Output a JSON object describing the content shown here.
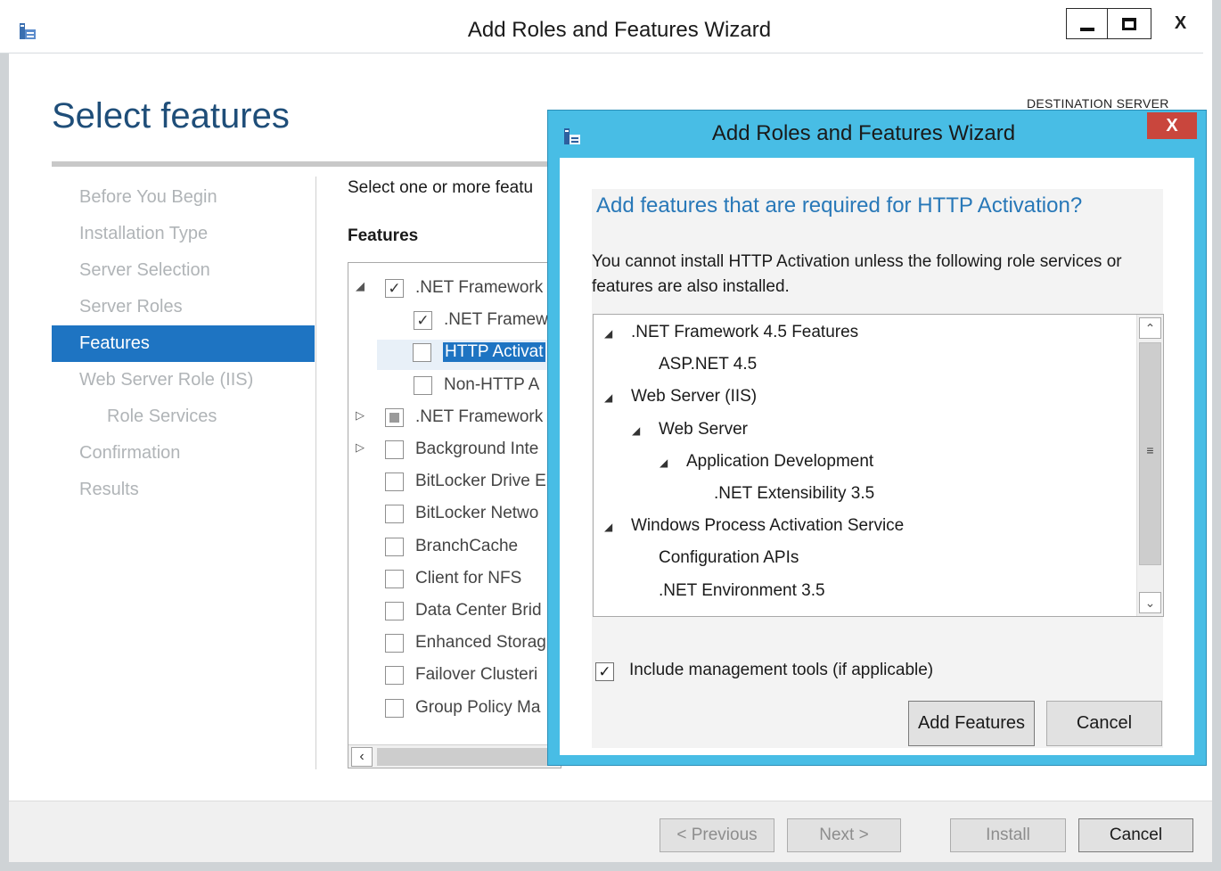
{
  "window": {
    "title": "Add Roles and Features Wizard",
    "destination_label": "DESTINATION SERVER",
    "close_glyph": "X"
  },
  "page": {
    "title": "Select features",
    "prompt": "Select one or more featu",
    "features_heading": "Features"
  },
  "nav": {
    "items": [
      {
        "label": "Before You Begin",
        "state": "disabled"
      },
      {
        "label": "Installation Type",
        "state": "disabled"
      },
      {
        "label": "Server Selection",
        "state": "disabled"
      },
      {
        "label": "Server Roles",
        "state": "disabled"
      },
      {
        "label": "Features",
        "state": "active"
      },
      {
        "label": "Web Server Role (IIS)",
        "state": "disabled"
      },
      {
        "label": "Role Services",
        "state": "disabled"
      },
      {
        "label": "Confirmation",
        "state": "disabled"
      },
      {
        "label": "Results",
        "state": "disabled"
      }
    ]
  },
  "features": {
    "rows": [
      {
        "label": ".NET Framework",
        "checked": "checked",
        "expander": "expanded"
      },
      {
        "label": ".NET Framew",
        "checked": "checked",
        "expander": ""
      },
      {
        "label": "HTTP Activat",
        "checked": "unchecked",
        "expander": "",
        "selected": true
      },
      {
        "label": "Non-HTTP A",
        "checked": "unchecked",
        "expander": ""
      },
      {
        "label": ".NET Framework",
        "checked": "partial",
        "expander": "collapsed"
      },
      {
        "label": "Background Inte",
        "checked": "unchecked",
        "expander": "collapsed"
      },
      {
        "label": "BitLocker Drive E",
        "checked": "unchecked",
        "expander": ""
      },
      {
        "label": "BitLocker Netwo",
        "checked": "unchecked",
        "expander": ""
      },
      {
        "label": "BranchCache",
        "checked": "unchecked",
        "expander": ""
      },
      {
        "label": "Client for NFS",
        "checked": "unchecked",
        "expander": ""
      },
      {
        "label": "Data Center Brid",
        "checked": "unchecked",
        "expander": ""
      },
      {
        "label": "Enhanced Storag",
        "checked": "unchecked",
        "expander": ""
      },
      {
        "label": "Failover Clusteri",
        "checked": "unchecked",
        "expander": ""
      },
      {
        "label": "Group Policy Ma",
        "checked": "unchecked",
        "expander": ""
      }
    ]
  },
  "footer": {
    "previous": "< Previous",
    "next": "Next >",
    "install": "Install",
    "cancel": "Cancel"
  },
  "dialog": {
    "title": "Add Roles and Features Wizard",
    "close_glyph": "X",
    "question": "Add features that are required for HTTP Activation?",
    "description": "You cannot install HTTP Activation unless the following role services or features are also installed.",
    "tree": [
      {
        "label": ".NET Framework 4.5 Features",
        "expanded": true
      },
      {
        "label": "ASP.NET 4.5",
        "expanded": false
      },
      {
        "label": "Web Server (IIS)",
        "expanded": true
      },
      {
        "label": "Web Server",
        "expanded": true
      },
      {
        "label": "Application Development",
        "expanded": true
      },
      {
        "label": ".NET Extensibility 3.5",
        "expanded": false
      },
      {
        "label": "Windows Process Activation Service",
        "expanded": true
      },
      {
        "label": "Configuration APIs",
        "expanded": false
      },
      {
        "label": ".NET Environment 3.5",
        "expanded": false
      }
    ],
    "include_tools_label": "Include management tools (if applicable)",
    "include_tools_checked": true,
    "add_features_button": "Add Features",
    "cancel_button": "Cancel"
  },
  "colors": {
    "accent": "#1e74c2",
    "dialog_frame": "#48bde5",
    "close_red": "#c9463d",
    "question_blue": "#2878b8"
  },
  "icons": {
    "app": "server-manager-icon",
    "tree_expanded": "triangle-expanded-icon",
    "tree_collapsed": "triangle-collapsed-icon",
    "checkmark": "checkmark-icon"
  }
}
